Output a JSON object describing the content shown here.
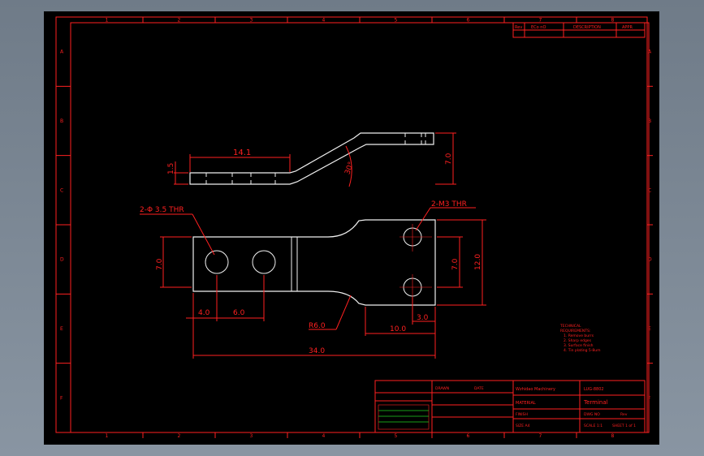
{
  "frame": {
    "columns": [
      "1",
      "2",
      "3",
      "4",
      "5",
      "6",
      "7",
      "8"
    ],
    "rows": [
      "A",
      "B",
      "C",
      "D",
      "E",
      "F"
    ]
  },
  "revision_table": {
    "headers": [
      "Rev",
      "ECo nO",
      "DESCRIPTION",
      "APPR"
    ]
  },
  "dimensions": {
    "side_length": "14.1",
    "side_thickness": "1.5",
    "side_height": "7.0",
    "side_angle": "30°",
    "hole_note": "2-Φ 3.5 THR",
    "tap_note": "2-M3 THR",
    "left_width": "7.0",
    "right_hole_spacing": "7.0",
    "right_width": "12.0",
    "hole_offset": "4.0",
    "hole_pitch": "6.0",
    "fillet": "R6.0",
    "right_length": "10.0",
    "tap_offset": "3.0",
    "overall_length": "34.0"
  },
  "title_block": {
    "company": "Wzhidao Machinery",
    "part_no": "LUG-8802",
    "part_name": "Terminal",
    "rev": "Rev",
    "sheet": "SHEET 1 of 1",
    "scale": "SCALE 1:1",
    "size": "SIZE A4",
    "dwg_no": "DWG NO",
    "material": "MATERIAL",
    "finish": "FINISH",
    "drawn": "DRAWN",
    "date": "DATE"
  },
  "notes": {
    "lines": [
      "TECHNICAL",
      "REQUIREMENTS:",
      "1. Remove burrs",
      "2. Sharp edges",
      "3. Surface finish",
      "4. Tin plating 5-8um"
    ]
  },
  "colors": {
    "frame": "#ff2020",
    "geometry": "#f0f0f0",
    "background": "#000000"
  }
}
